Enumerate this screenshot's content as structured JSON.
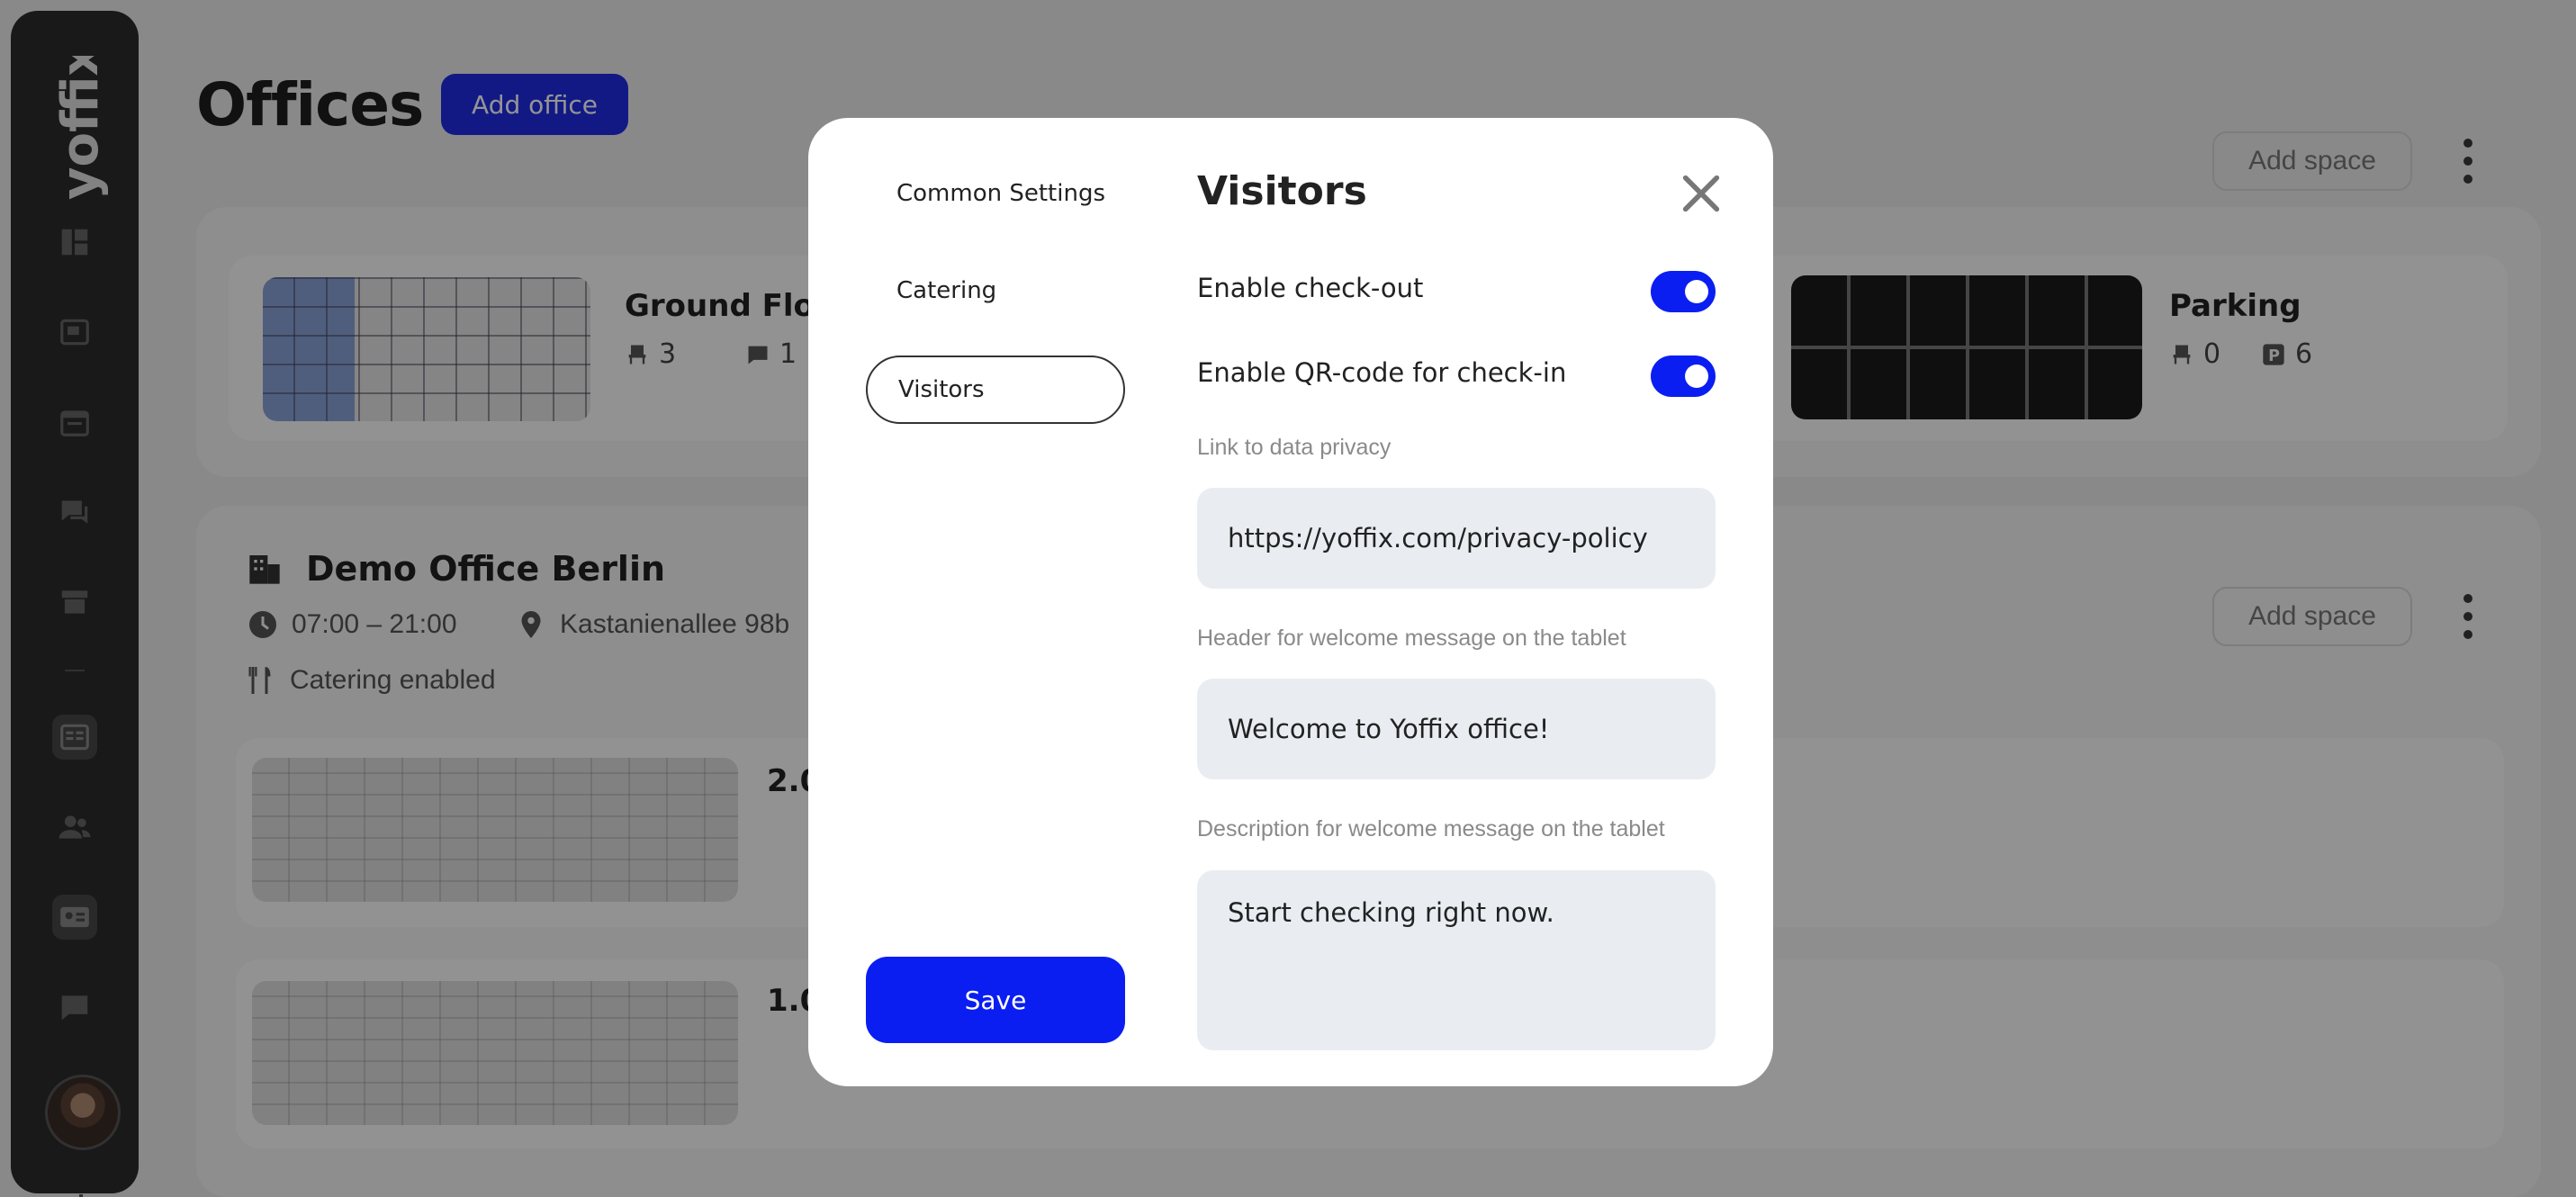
{
  "brand": {
    "logo_text": "yoffix",
    "primary_color": "#0a1ef2"
  },
  "page": {
    "title": "Offices",
    "add_office_label": "Add office"
  },
  "sidebar": {
    "items": [
      {
        "icon": "dashboard-icon"
      },
      {
        "icon": "desk-booking-icon"
      },
      {
        "icon": "calendar-icon"
      },
      {
        "icon": "chat-icon"
      },
      {
        "icon": "archive-icon"
      },
      {
        "icon": "offices-icon",
        "active": true
      },
      {
        "icon": "users-icon"
      },
      {
        "icon": "visitors-icon"
      },
      {
        "icon": "messages-icon"
      }
    ]
  },
  "office1": {
    "add_space_label": "Add space",
    "spaces": [
      {
        "name": "Ground Floo",
        "seats": "3",
        "rooms": "1"
      },
      {
        "name": "Parking",
        "seats": "0",
        "parking": "6"
      }
    ]
  },
  "office2": {
    "name": "Demo Office Berlin",
    "hours": "07:00 – 21:00",
    "address": "Kastanienallee 98b",
    "catering": "Catering enabled",
    "add_space_label": "Add space",
    "spaces": [
      {
        "name": "2.0"
      },
      {
        "name": "1.0"
      }
    ]
  },
  "modal": {
    "tabs": [
      "Common Settings",
      "Catering",
      "Visitors"
    ],
    "selected_tab": "Visitors",
    "save_label": "Save",
    "title": "Visitors",
    "enable_checkout": {
      "label": "Enable check-out",
      "on": true
    },
    "enable_qr": {
      "label": "Enable QR-code for check-in",
      "on": true
    },
    "privacy": {
      "label": "Link to data privacy",
      "value": "https://yoffix.com/privacy-policy"
    },
    "welcome_header": {
      "label": "Header for welcome message on the tablet",
      "value": "Welcome to Yoffix office!"
    },
    "welcome_description": {
      "label": "Description for welcome message on the tablet",
      "value": "Start checking right now."
    }
  }
}
